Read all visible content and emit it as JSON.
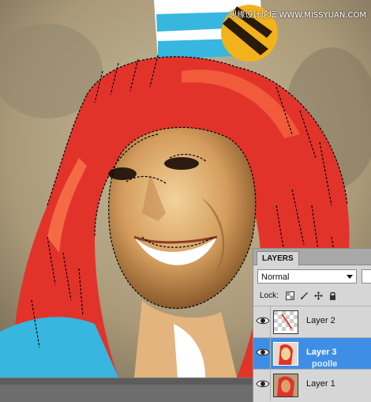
{
  "watermark": "思缘设计论坛 WWW.MISSYUAN.COM",
  "watermark2": "poolle",
  "layers_panel": {
    "tab_label": "LAYERS",
    "blend_mode": "Normal",
    "lock_label": "Lock:",
    "layers": [
      {
        "name": "Layer 2",
        "visible": true,
        "selected": false
      },
      {
        "name": "Layer 3",
        "visible": true,
        "selected": true
      },
      {
        "name": "Layer 1",
        "visible": true,
        "selected": false
      }
    ]
  },
  "colors": {
    "selection_blue": "#3f8ee6",
    "panel_bg": "#d6d6d6",
    "hair_red": "#e2332b",
    "skin": "#d9a46a"
  },
  "icons": [
    "transparency-lock-icon",
    "brush-lock-icon",
    "move-lock-icon",
    "padlock-icon",
    "eye-icon",
    "chain-icon"
  ]
}
